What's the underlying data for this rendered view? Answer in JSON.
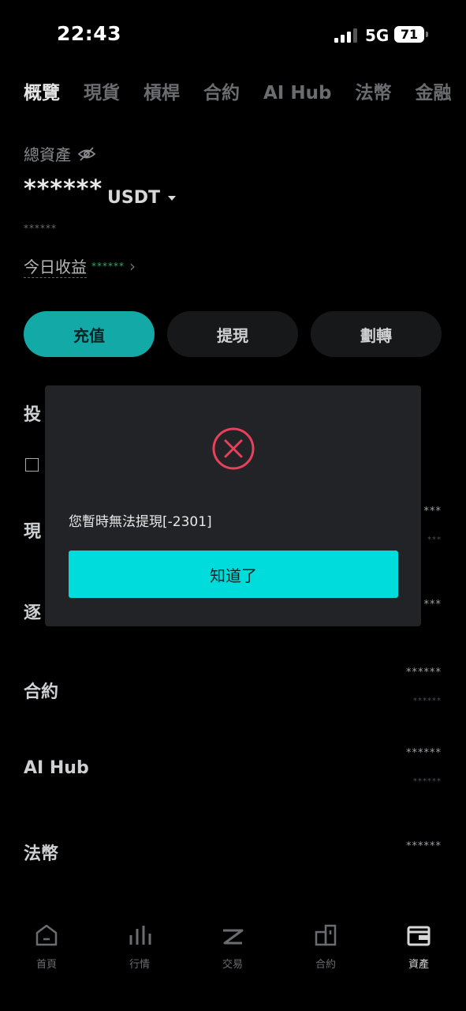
{
  "status": {
    "time": "22:43",
    "network": "5G",
    "battery": "71"
  },
  "tabs": [
    "概覽",
    "現貨",
    "槓桿",
    "合約",
    "AI Hub",
    "法幣",
    "金融"
  ],
  "overview": {
    "total_label": "總資產",
    "balance": "******",
    "currency": "USDT",
    "sub_balance": "******",
    "pnl_label": "今日收益",
    "pnl_value": "******"
  },
  "actions": {
    "deposit": "充值",
    "withdraw": "提現",
    "transfer": "劃轉"
  },
  "sections": {
    "invest_partial": "投",
    "spot_partial": "現",
    "margin_partial": "逐",
    "futures": "合約",
    "aihub": "AI Hub",
    "fiat": "法幣"
  },
  "amounts": {
    "spot_main": "***",
    "spot_sub": "***",
    "margin_main": "***",
    "futures_main": "******",
    "futures_sub": "******",
    "aihub_main": "******",
    "aihub_sub": "******",
    "fiat_main": "******"
  },
  "modal": {
    "message": "您暫時無法提現[-2301]",
    "button": "知道了",
    "icon_color": "#e8405a"
  },
  "nav": [
    "首頁",
    "行情",
    "交易",
    "合約",
    "資產"
  ],
  "colors": {
    "accent": "#12a9a6",
    "modal_button": "#00dcdc",
    "pnl_green": "#23b26a"
  }
}
